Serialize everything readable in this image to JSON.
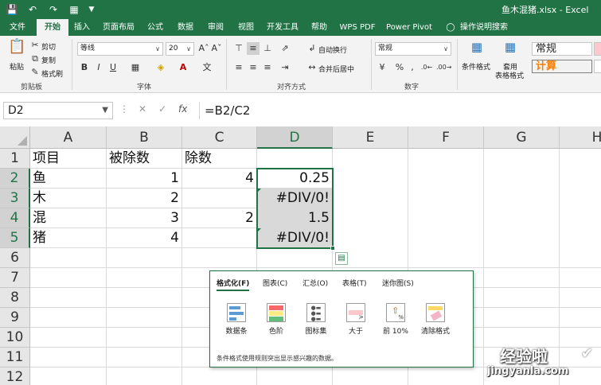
{
  "window": {
    "title": "鱼木混猪.xlsx - Excel"
  },
  "colors": {
    "accent": "#217346",
    "selection": "#d9d9d9",
    "error_flag": "#1e7145"
  },
  "quick_access": {
    "icons": [
      "save-icon",
      "undo-icon",
      "redo-icon",
      "form-icon",
      "customize-icon"
    ]
  },
  "tabs": [
    "文件",
    "开始",
    "插入",
    "页面布局",
    "公式",
    "数据",
    "审阅",
    "视图",
    "开发工具",
    "帮助",
    "WPS PDF",
    "Power Pivot",
    "操作说明搜索"
  ],
  "active_tab": "开始",
  "ribbon": {
    "clipboard": {
      "paste": "粘贴",
      "cut": "剪切",
      "copy": "复制",
      "format_painter": "格式刷",
      "label": "剪贴板"
    },
    "font": {
      "name": "等线",
      "size": "20",
      "label": "字体"
    },
    "alignment": {
      "wrap": "自动换行",
      "merge": "合并后居中",
      "label": "对齐方式"
    },
    "number": {
      "format": "常规",
      "percent": "%",
      "comma": ",",
      "label": "数字"
    },
    "styles": {
      "conditional": "条件格式",
      "table": "套用",
      "table2": "表格格式",
      "normal": "常规",
      "calc": "计算"
    }
  },
  "formula_bar": {
    "name_box": "D2",
    "formula": "=B2/C2",
    "fx": "fx"
  },
  "columns": [
    "A",
    "B",
    "C",
    "D",
    "E",
    "F",
    "G",
    "H"
  ],
  "selected_column": "D",
  "rows": [
    "1",
    "2",
    "3",
    "4",
    "5",
    "6",
    "7",
    "8",
    "9",
    "10",
    "11",
    "12"
  ],
  "cells": {
    "A1": "项目",
    "B1": "被除数",
    "C1": "除数",
    "A2": "鱼",
    "B2": "1",
    "C2": "4",
    "D2": "0.25",
    "A3": "木",
    "B3": "2",
    "D3": "#DIV/0!",
    "A4": "混",
    "B4": "3",
    "C4": "2",
    "D4": "1.5",
    "A5": "猪",
    "B5": "4",
    "D5": "#DIV/0!"
  },
  "quick_analysis": {
    "tabs": [
      "格式化(F)",
      "图表(C)",
      "汇总(O)",
      "表格(T)",
      "迷你图(S)"
    ],
    "options": [
      {
        "label": "数据条",
        "icon": "data-bars-icon"
      },
      {
        "label": "色阶",
        "icon": "color-scale-icon"
      },
      {
        "label": "图标集",
        "icon": "icon-set-icon"
      },
      {
        "label": "大于",
        "icon": "greater-than-icon"
      },
      {
        "label": "前 10%",
        "icon": "top-10-icon"
      },
      {
        "label": "清除格式",
        "icon": "clear-format-icon"
      }
    ],
    "description": "条件格式使用规则突出显示感兴趣的数据。"
  },
  "watermark": {
    "line1": "经验啦",
    "line2": "jingyanla.com"
  }
}
